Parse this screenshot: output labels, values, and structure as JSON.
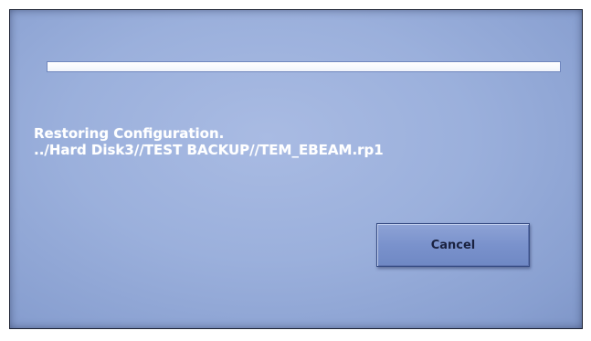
{
  "dialog": {
    "progress": {
      "fraction": 1.0
    },
    "message": {
      "line1": "Restoring Configuration.",
      "line2": "../Hard Disk3//TEST BACKUP//TEM_EBEAM.rp1"
    },
    "cancel_label": "Cancel"
  },
  "colors": {
    "background": "#9bb0dc",
    "progress_fill": "#ffffff",
    "text": "#ffffff",
    "button": "#7a92cc"
  }
}
